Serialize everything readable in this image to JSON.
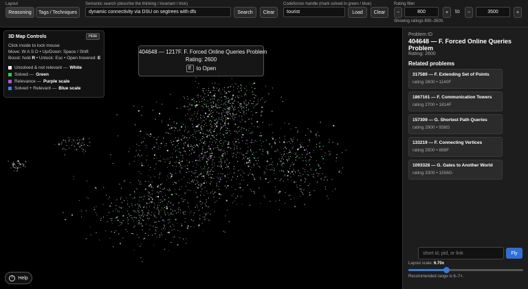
{
  "toolbar": {
    "layout_label": "Layout",
    "reasoning_btn": "Reasoning",
    "tags_btn": "Tags / Techniques",
    "search_label": "Semantic search (describe the thinking / invariant / trick)",
    "search_value": "dynamic connectivity via DSU on segtrees with dfs",
    "search_btn": "Search",
    "clear_btn": "Clear",
    "handle_label": "Codeforces handle (mark solved in green / blue)",
    "handle_value": "tourist",
    "load_btn": "Load",
    "clear2_btn": "Clear",
    "rating_label": "Rating filter",
    "minus": "−",
    "plus": "+",
    "rating_min": "800",
    "to": "to",
    "rating_max": "3500",
    "showing": "Showing ratings 800–3500."
  },
  "controls": {
    "title": "3D Map Controls",
    "hide": "Hide",
    "line1": "Click inside to lock mouse",
    "line2": "Move: W A S D • Up/Down: Space / Shift",
    "line3_pre": "Boost: hold ",
    "line3_r": "R",
    "line3_mid": " • Unlock: Esc • Open hovered: ",
    "line3_e": "E",
    "legend": [
      {
        "text": "Unsolved & not relevant —",
        "strong": "White",
        "color": "#ffffff"
      },
      {
        "text": "Solved —",
        "strong": "Green",
        "color": "#34c759"
      },
      {
        "text": "Relevance —",
        "strong": "Purple scale",
        "color": "#a35bd9"
      },
      {
        "text": "Solved + Relevant —",
        "strong": "Blue scale",
        "color": "#4a7de0"
      }
    ]
  },
  "tooltip": {
    "title": "404648 — 1217F. F. Forced Online Queries Problem",
    "rating": "Rating: 2600",
    "key": "E",
    "open": "to Open"
  },
  "help": "Help",
  "panel": {
    "pid_label": "Problem ID",
    "pid_title": "404648 — F. Forced Online Queries Problem",
    "rating": "Rating: 2600",
    "related_head": "Related problems",
    "related": [
      {
        "title": "317589 — F. Extending Set of Points",
        "sub": "rating 2600 • 1140F"
      },
      {
        "title": "1867161 — F. Communication Towers",
        "sub": "rating 2700 • 1814F"
      },
      {
        "title": "157309 — G. Shortest Path Queries",
        "sub": "rating 2900 • 938G"
      },
      {
        "title": "133219 — F. Connecting Vertices",
        "sub": "rating 2500 • 888F"
      },
      {
        "title": "1093328 — G. Gates to Another World",
        "sub": "rating 3300 • 1556G"
      }
    ],
    "fly_placeholder": "short id, pid, or link",
    "fly_btn": "Fly",
    "scale_label": "Layout scale:",
    "scale_value": "6.70x",
    "scale_fraction": 0.33,
    "recommended": "Recommended range is 6–7×."
  }
}
